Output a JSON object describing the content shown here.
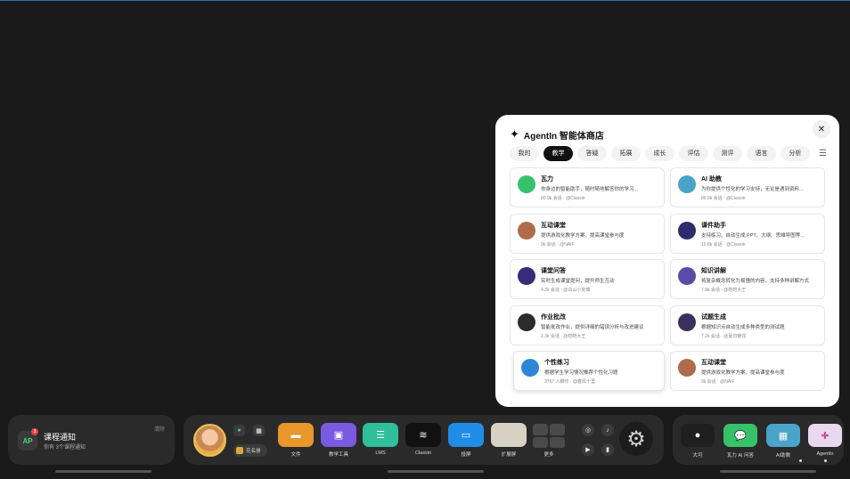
{
  "store": {
    "title": "AgentIn 智能体商店",
    "close": "✕",
    "tabs": [
      "我的",
      "教学",
      "答疑",
      "拓展",
      "成长",
      "评估",
      "测评",
      "语言",
      "分析"
    ],
    "active_tab": "教学",
    "cards": [
      {
        "name": "瓦力",
        "desc": "你身边的智能助手，随时随地解答你的学习...",
        "meta": "80.9k 会话 · @Classin",
        "color": "#36c26b"
      },
      {
        "name": "AI 助教",
        "desc": "为你提供个性化的学习支持，无论是遇到资料...",
        "meta": "86.9k 会话 · @Classin",
        "color": "#4aa3c8"
      },
      {
        "name": "互动课堂",
        "desc": "提供游戏化教学方案，提高课堂参与度",
        "meta": "9k 会话 · @NAIF",
        "color": "#b06b4a"
      },
      {
        "name": "课件助手",
        "desc": "支持练习、自动生成 PPT、大纲、思维导图等...",
        "meta": "10.8k 会话 · @Classin",
        "color": "#2c2c6e"
      },
      {
        "name": "课堂问答",
        "desc": "实时生成课堂提问，提升师生互动",
        "meta": "4.2k 会话 · @白山小克博",
        "color": "#3a2a7a"
      },
      {
        "name": "知识讲解",
        "desc": "将复杂概念转化为易懂的内容，支持多种讲解方式",
        "meta": "7.9k 会话 · @皑皑大王",
        "color": "#5b4aa8"
      },
      {
        "name": "作业批改",
        "desc": "智能批改作业，提供详细的错误分析与改进建议",
        "meta": "2.3k 会话 · @皑皑大王",
        "color": "#2b2b2b"
      },
      {
        "name": "试题生成",
        "desc": "根据知识点自动生成多种类型的测试题",
        "meta": "7.2k 会话 · @夏日暖花",
        "color": "#3d2f5c"
      },
      {
        "name": "个性练习",
        "desc": "根据学生学习情况推荐个性化习题",
        "meta": "3767 人脚印 · @春风十里",
        "color": "#2e86d6"
      },
      {
        "name": "互动课堂",
        "desc": "提供游戏化教学方案，提高课堂参与度",
        "meta": "9k 会话 · @NAIF",
        "color": "#b06b4a"
      }
    ]
  },
  "notify": {
    "badge": "3",
    "icon_text": "AP",
    "title": "课程通知",
    "subtitle": "你有 3个课程通知",
    "dismiss": "清除"
  },
  "dock": {
    "roster_label": "花名册",
    "apps": [
      {
        "label": "文件",
        "color": "#e9962a",
        "glyph": "▬"
      },
      {
        "label": "教学工具",
        "color": "#7a5ae0",
        "glyph": "▣"
      },
      {
        "label": "LMS",
        "color": "#2fbf9a",
        "glyph": "☰"
      },
      {
        "label": "Classin",
        "color": "#111111",
        "glyph": "≋"
      },
      {
        "label": "投屏",
        "color": "#1f8de8",
        "glyph": "▭"
      },
      {
        "label": "扩展屏",
        "color": "#d8d2c4",
        "glyph": ""
      }
    ],
    "more_label": "更多",
    "settings_glyph": "⚙"
  },
  "dock_right": {
    "apps": [
      {
        "label": "大可",
        "color": "#1f1f1f",
        "glyph": "●"
      },
      {
        "label": "瓦力 AI 问答",
        "color": "#36c26b",
        "glyph": "💬"
      },
      {
        "label": "AI助教",
        "color": "#4aa3c8",
        "glyph": "▦"
      },
      {
        "label": "AgentIn",
        "color": "#e8d9ef",
        "glyph": "✚"
      }
    ]
  }
}
